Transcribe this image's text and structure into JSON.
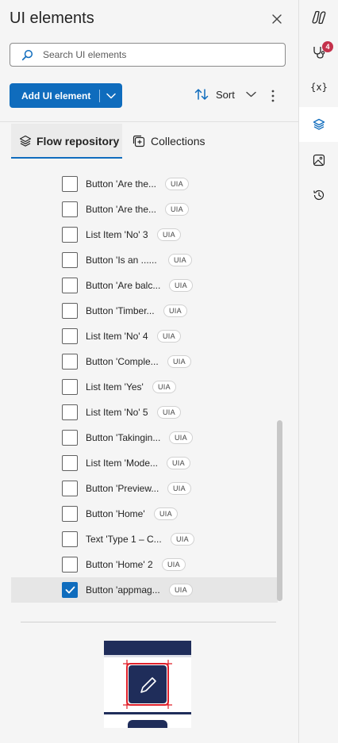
{
  "panel": {
    "title": "UI elements",
    "search_placeholder": "Search UI elements",
    "add_label": "Add UI element",
    "sort_label": "Sort"
  },
  "tabs": [
    {
      "label": "Flow repository",
      "active": true
    },
    {
      "label": "Collections",
      "active": false
    }
  ],
  "items": [
    {
      "label": "Button 'Are the...",
      "badge": "UIA",
      "checked": false
    },
    {
      "label": "Button 'Are the...",
      "badge": "UIA",
      "checked": false
    },
    {
      "label": "List Item 'No' 3",
      "badge": "UIA",
      "checked": false
    },
    {
      "label": "Button 'Is an  ......",
      "badge": "UIA",
      "checked": false
    },
    {
      "label": "Button 'Are balc...",
      "badge": "UIA",
      "checked": false
    },
    {
      "label": "Button 'Timber...",
      "badge": "UIA",
      "checked": false
    },
    {
      "label": "List Item 'No' 4",
      "badge": "UIA",
      "checked": false
    },
    {
      "label": "Button 'Comple...",
      "badge": "UIA",
      "checked": false
    },
    {
      "label": "List Item 'Yes'",
      "badge": "UIA",
      "checked": false
    },
    {
      "label": "List Item 'No' 5",
      "badge": "UIA",
      "checked": false
    },
    {
      "label": "Button 'Takingin...",
      "badge": "UIA",
      "checked": false
    },
    {
      "label": "List Item 'Mode...",
      "badge": "UIA",
      "checked": false
    },
    {
      "label": "Button 'Preview...",
      "badge": "UIA",
      "checked": false
    },
    {
      "label": "Button 'Home'",
      "badge": "UIA",
      "checked": false
    },
    {
      "label": "Text 'Type 1 – C...",
      "badge": "UIA",
      "checked": false
    },
    {
      "label": "Button 'Home' 2",
      "badge": "UIA",
      "checked": false
    },
    {
      "label": "Button 'appmag...",
      "badge": "UIA",
      "checked": true
    }
  ],
  "rail": {
    "badge_count": "4",
    "variables_glyph": "{x}"
  },
  "colors": {
    "accent": "#0f6cbd",
    "badge_red": "#c4314b",
    "preview_navy": "#1f2d5a",
    "preview_red": "#e0202a"
  },
  "icons": [
    "close-icon",
    "search-icon",
    "chevron-down-icon",
    "sort-icon",
    "more-icon",
    "layers-icon",
    "collections-icon",
    "copilot-icon",
    "stethoscope-icon",
    "variables-icon",
    "image-icon",
    "history-icon",
    "checkmark-icon"
  ]
}
